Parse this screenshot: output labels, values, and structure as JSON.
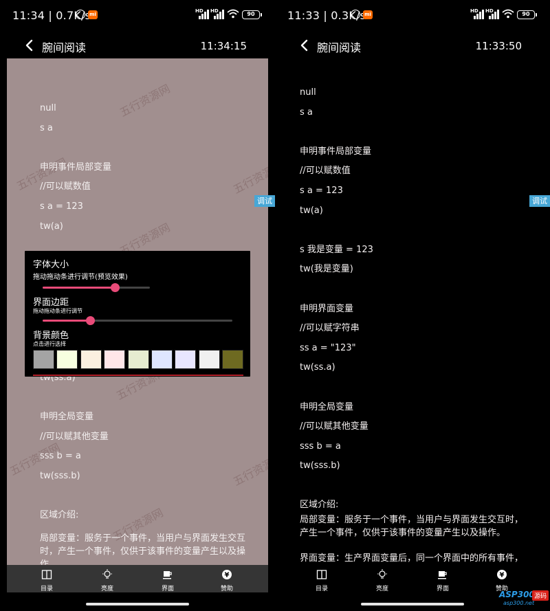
{
  "left": {
    "status": {
      "time": "11:34",
      "speed": "0.7K/s",
      "battery": "90"
    },
    "toolbar": {
      "title": "腕间阅读",
      "clock": "11:34:15"
    },
    "debug_label": "调试",
    "watermark": "五行资源网",
    "lines_top": [
      "null",
      "s a",
      "",
      "申明事件局部变量",
      "//可以赋数值",
      "s a = 123",
      "tw(a)"
    ],
    "lines_bottom": [
      "tw(ss.a)",
      "",
      "申明全局变量",
      "//可以赋其他变量",
      "sss b = a",
      "tw(sss.b)",
      "",
      "区域介绍:"
    ],
    "last_para": "局部变量：服务于一个事件，当用户与界面发生交互时，产生一个事件，仅供于该事件的变量产生以及操作",
    "panel": {
      "font_title": "字体大小",
      "font_sub": "拖动拖动条进行调节(预览效果)",
      "font_level": 0.67,
      "margin_title": "界面边距",
      "margin_sub": "拖动拖动条进行调节",
      "margin_level": 0.25,
      "bg_title": "背景颜色",
      "bg_sub": "点击进行选择",
      "colors": [
        "#a4a4a4",
        "#f7ffe0",
        "#fbf0e0",
        "#ffe6e8",
        "#e6ecd0",
        "#dfe6ff",
        "#e8e6ff",
        "#f0f0f0",
        "#6e6a21"
      ]
    }
  },
  "right": {
    "status": {
      "time": "11:33",
      "speed": "0.3K/s",
      "battery": "90"
    },
    "toolbar": {
      "title": "腕间阅读",
      "clock": "11:33:50"
    },
    "debug_label": "调试",
    "lines": [
      "null",
      "s a",
      "",
      "申明事件局部变量",
      "//可以赋数值",
      "s a = 123",
      "tw(a)",
      "",
      "s 我是变量 = 123",
      "tw(我是变量)",
      "",
      "申明界面变量",
      "//可以赋字符串",
      "ss a = \"123\"",
      "tw(ss.a)",
      "",
      "申明全局变量",
      "//可以赋其他变量",
      "sss b = a",
      "tw(sss.b)",
      "",
      "区域介绍:"
    ],
    "para1": "局部变量：服务于一个事件，当用户与界面发生交互时，产生一个事件，仅供于该事件的变量产生以及操作。",
    "para2": "界面变量：生产界面变量后，同一个界面中的所有事件，均可对其进行操作。"
  },
  "bottom_nav": [
    {
      "label": "目录",
      "icon": "book-icon"
    },
    {
      "label": "亮度",
      "icon": "bulb-icon"
    },
    {
      "label": "界面",
      "icon": "cup-icon"
    },
    {
      "label": "赞助",
      "icon": "yuan-icon"
    }
  ],
  "brand": {
    "logo": "ASP300",
    "tag": "源码",
    "domain": "asp300.net"
  }
}
